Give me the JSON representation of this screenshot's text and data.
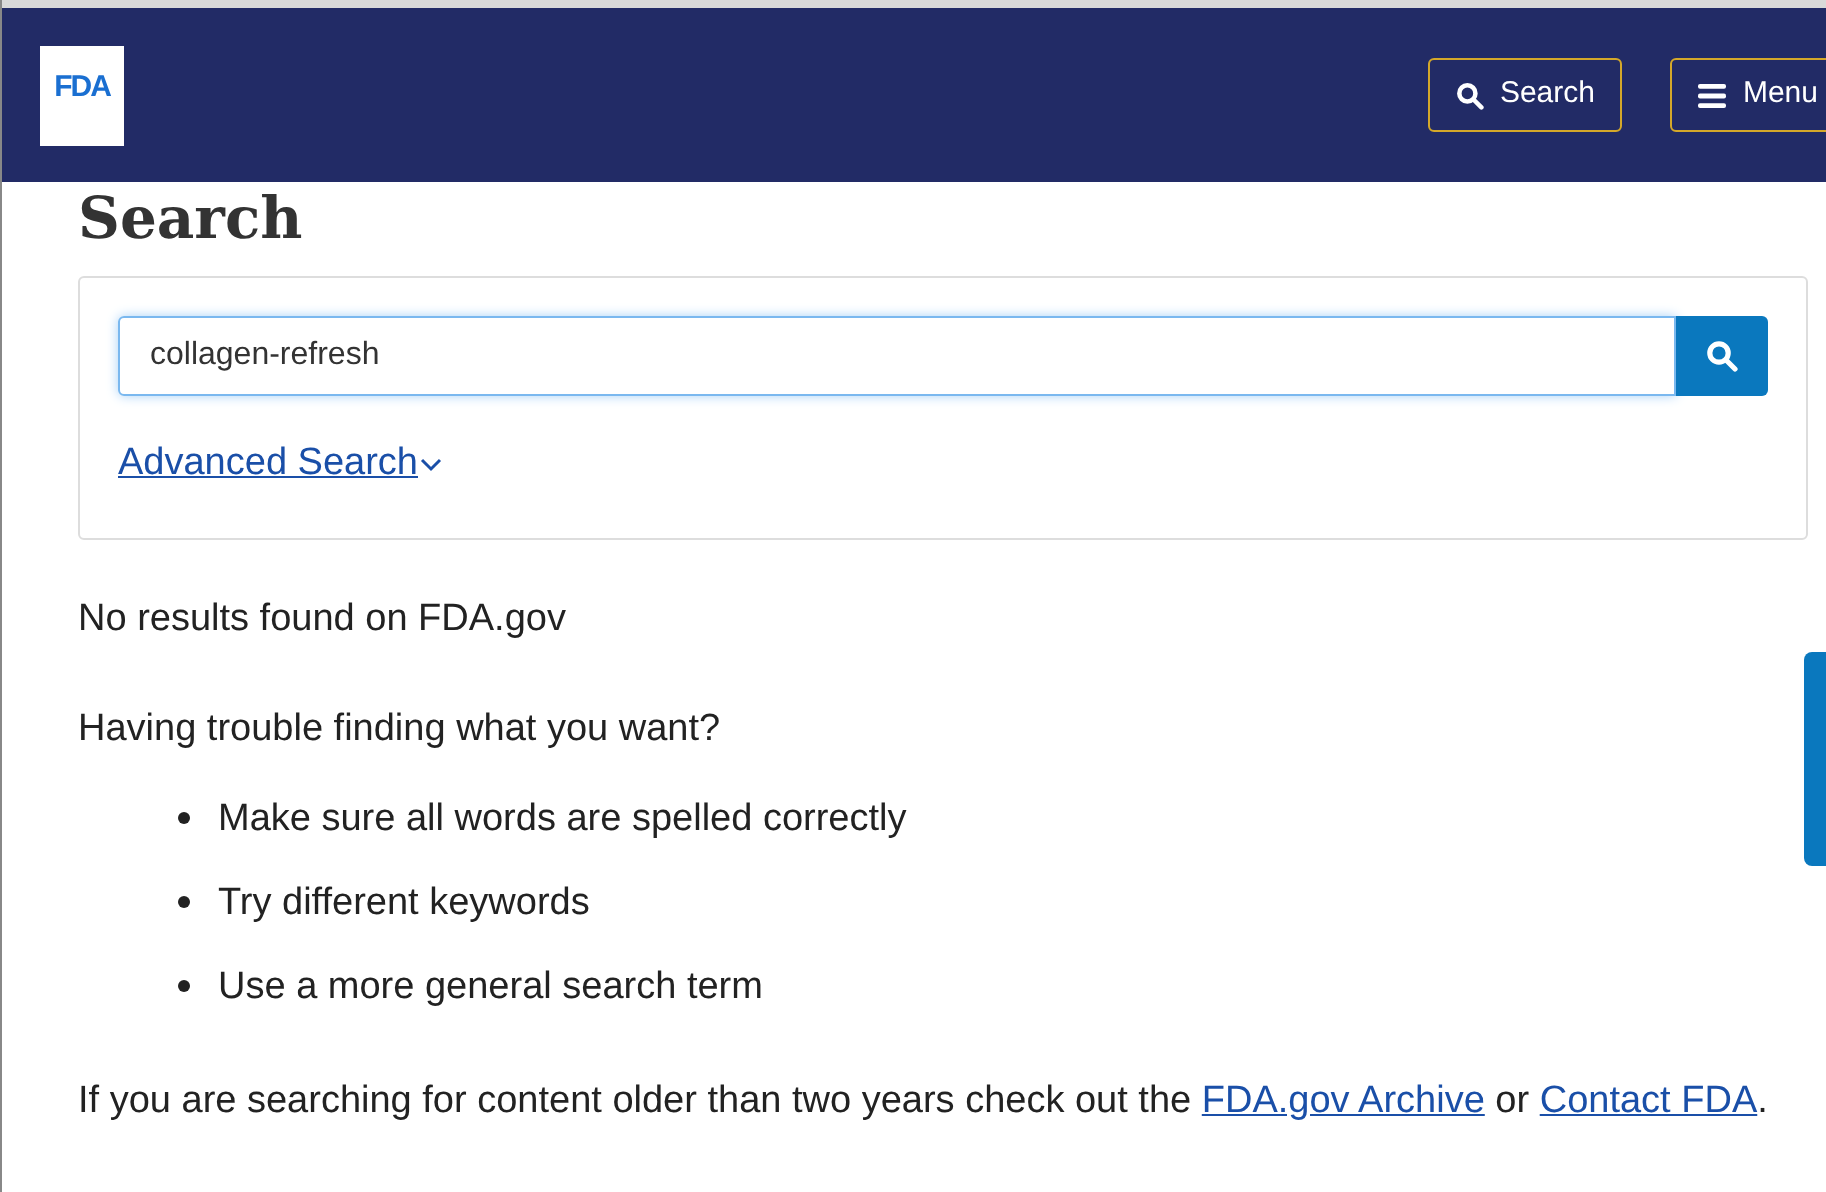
{
  "header": {
    "logo": "FDA",
    "buttons": [
      {
        "kind": "search",
        "label": "Search"
      },
      {
        "kind": "menu",
        "label": "Menu"
      }
    ]
  },
  "title": "Search",
  "search": {
    "value": "collagen-refresh",
    "advanced_link": "Advanced Search"
  },
  "results": {
    "message": "No results found on FDA.gov",
    "help_title": "Having trouble finding what you want?",
    "tips": [
      "Make sure all words are spelled correctly",
      "Try different keywords",
      "Use a more general search term"
    ],
    "footer": {
      "text_before": "If you are searching for content older than two years check out the",
      "archive_link": "FDA.gov Archive",
      "text_between": "or",
      "contact_link": "Contact FDA",
      "text_after": "."
    }
  }
}
